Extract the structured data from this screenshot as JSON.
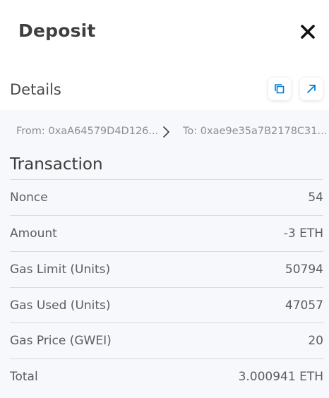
{
  "header": {
    "title": "Deposit"
  },
  "details": {
    "title": "Details"
  },
  "from_to": {
    "from": "From: 0xaA64579D4D126...",
    "to": "To: 0xae9e35a7B2178C31..."
  },
  "transaction": {
    "title": "Transaction",
    "rows": [
      {
        "label": "Nonce",
        "value": "54"
      },
      {
        "label": "Amount",
        "value": "-3 ETH"
      },
      {
        "label": "Gas Limit (Units)",
        "value": "50794"
      },
      {
        "label": "Gas Used (Units)",
        "value": "47057"
      },
      {
        "label": "Gas Price (GWEI)",
        "value": "20"
      },
      {
        "label": "Total",
        "value": "3.000941 ETH"
      }
    ]
  },
  "icons": {
    "close": "close-icon",
    "copy": "copy-icon",
    "open": "external-link-icon",
    "arrow": "chevron-right-icon"
  },
  "colors": {
    "accent": "#037dd6",
    "panel_bg": "#f7f8fb",
    "title_text": "#3f3f3f"
  }
}
